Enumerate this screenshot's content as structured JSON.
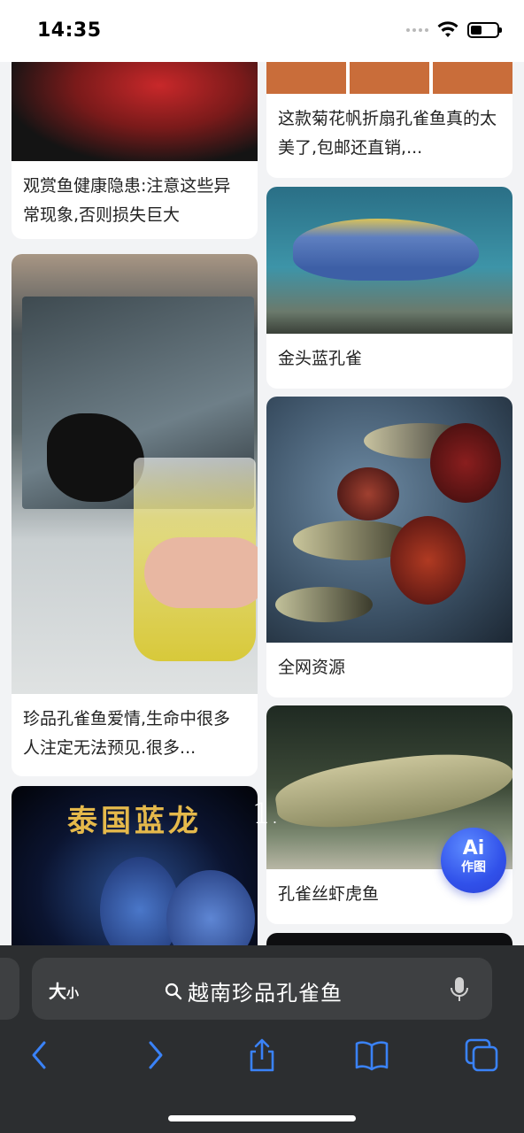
{
  "status_bar": {
    "time": "14:35"
  },
  "feed": {
    "left": [
      {
        "caption": "观赏鱼健康隐患:注意这些异常现象,否则损失巨大"
      },
      {
        "caption": "珍品孔雀鱼爱情,生命中很多人注定无法预见.很多..."
      },
      {
        "image_text": "泰国蓝龙"
      }
    ],
    "right": [
      {
        "caption": "这款菊花帆折扇孔雀鱼真的太美了,包邮还直销,..."
      },
      {
        "caption": "金头蓝孔雀"
      },
      {
        "caption": "全网资源"
      },
      {
        "caption": "孔雀丝虾虎鱼"
      }
    ]
  },
  "overlay_text": "1.",
  "ai_button": {
    "line1": "Ai",
    "line2": "作图"
  },
  "address_bar": {
    "text_size_label": "大",
    "text_size_small": "小",
    "query": "越南珍品孔雀鱼"
  },
  "colors": {
    "accent": "#3151ea",
    "toolbar_icon": "#3a82f7"
  },
  "icons": [
    "wifi-icon",
    "battery-icon",
    "search-icon",
    "mic-icon",
    "back-icon",
    "forward-icon",
    "share-icon",
    "bookmarks-icon",
    "tabs-icon"
  ]
}
